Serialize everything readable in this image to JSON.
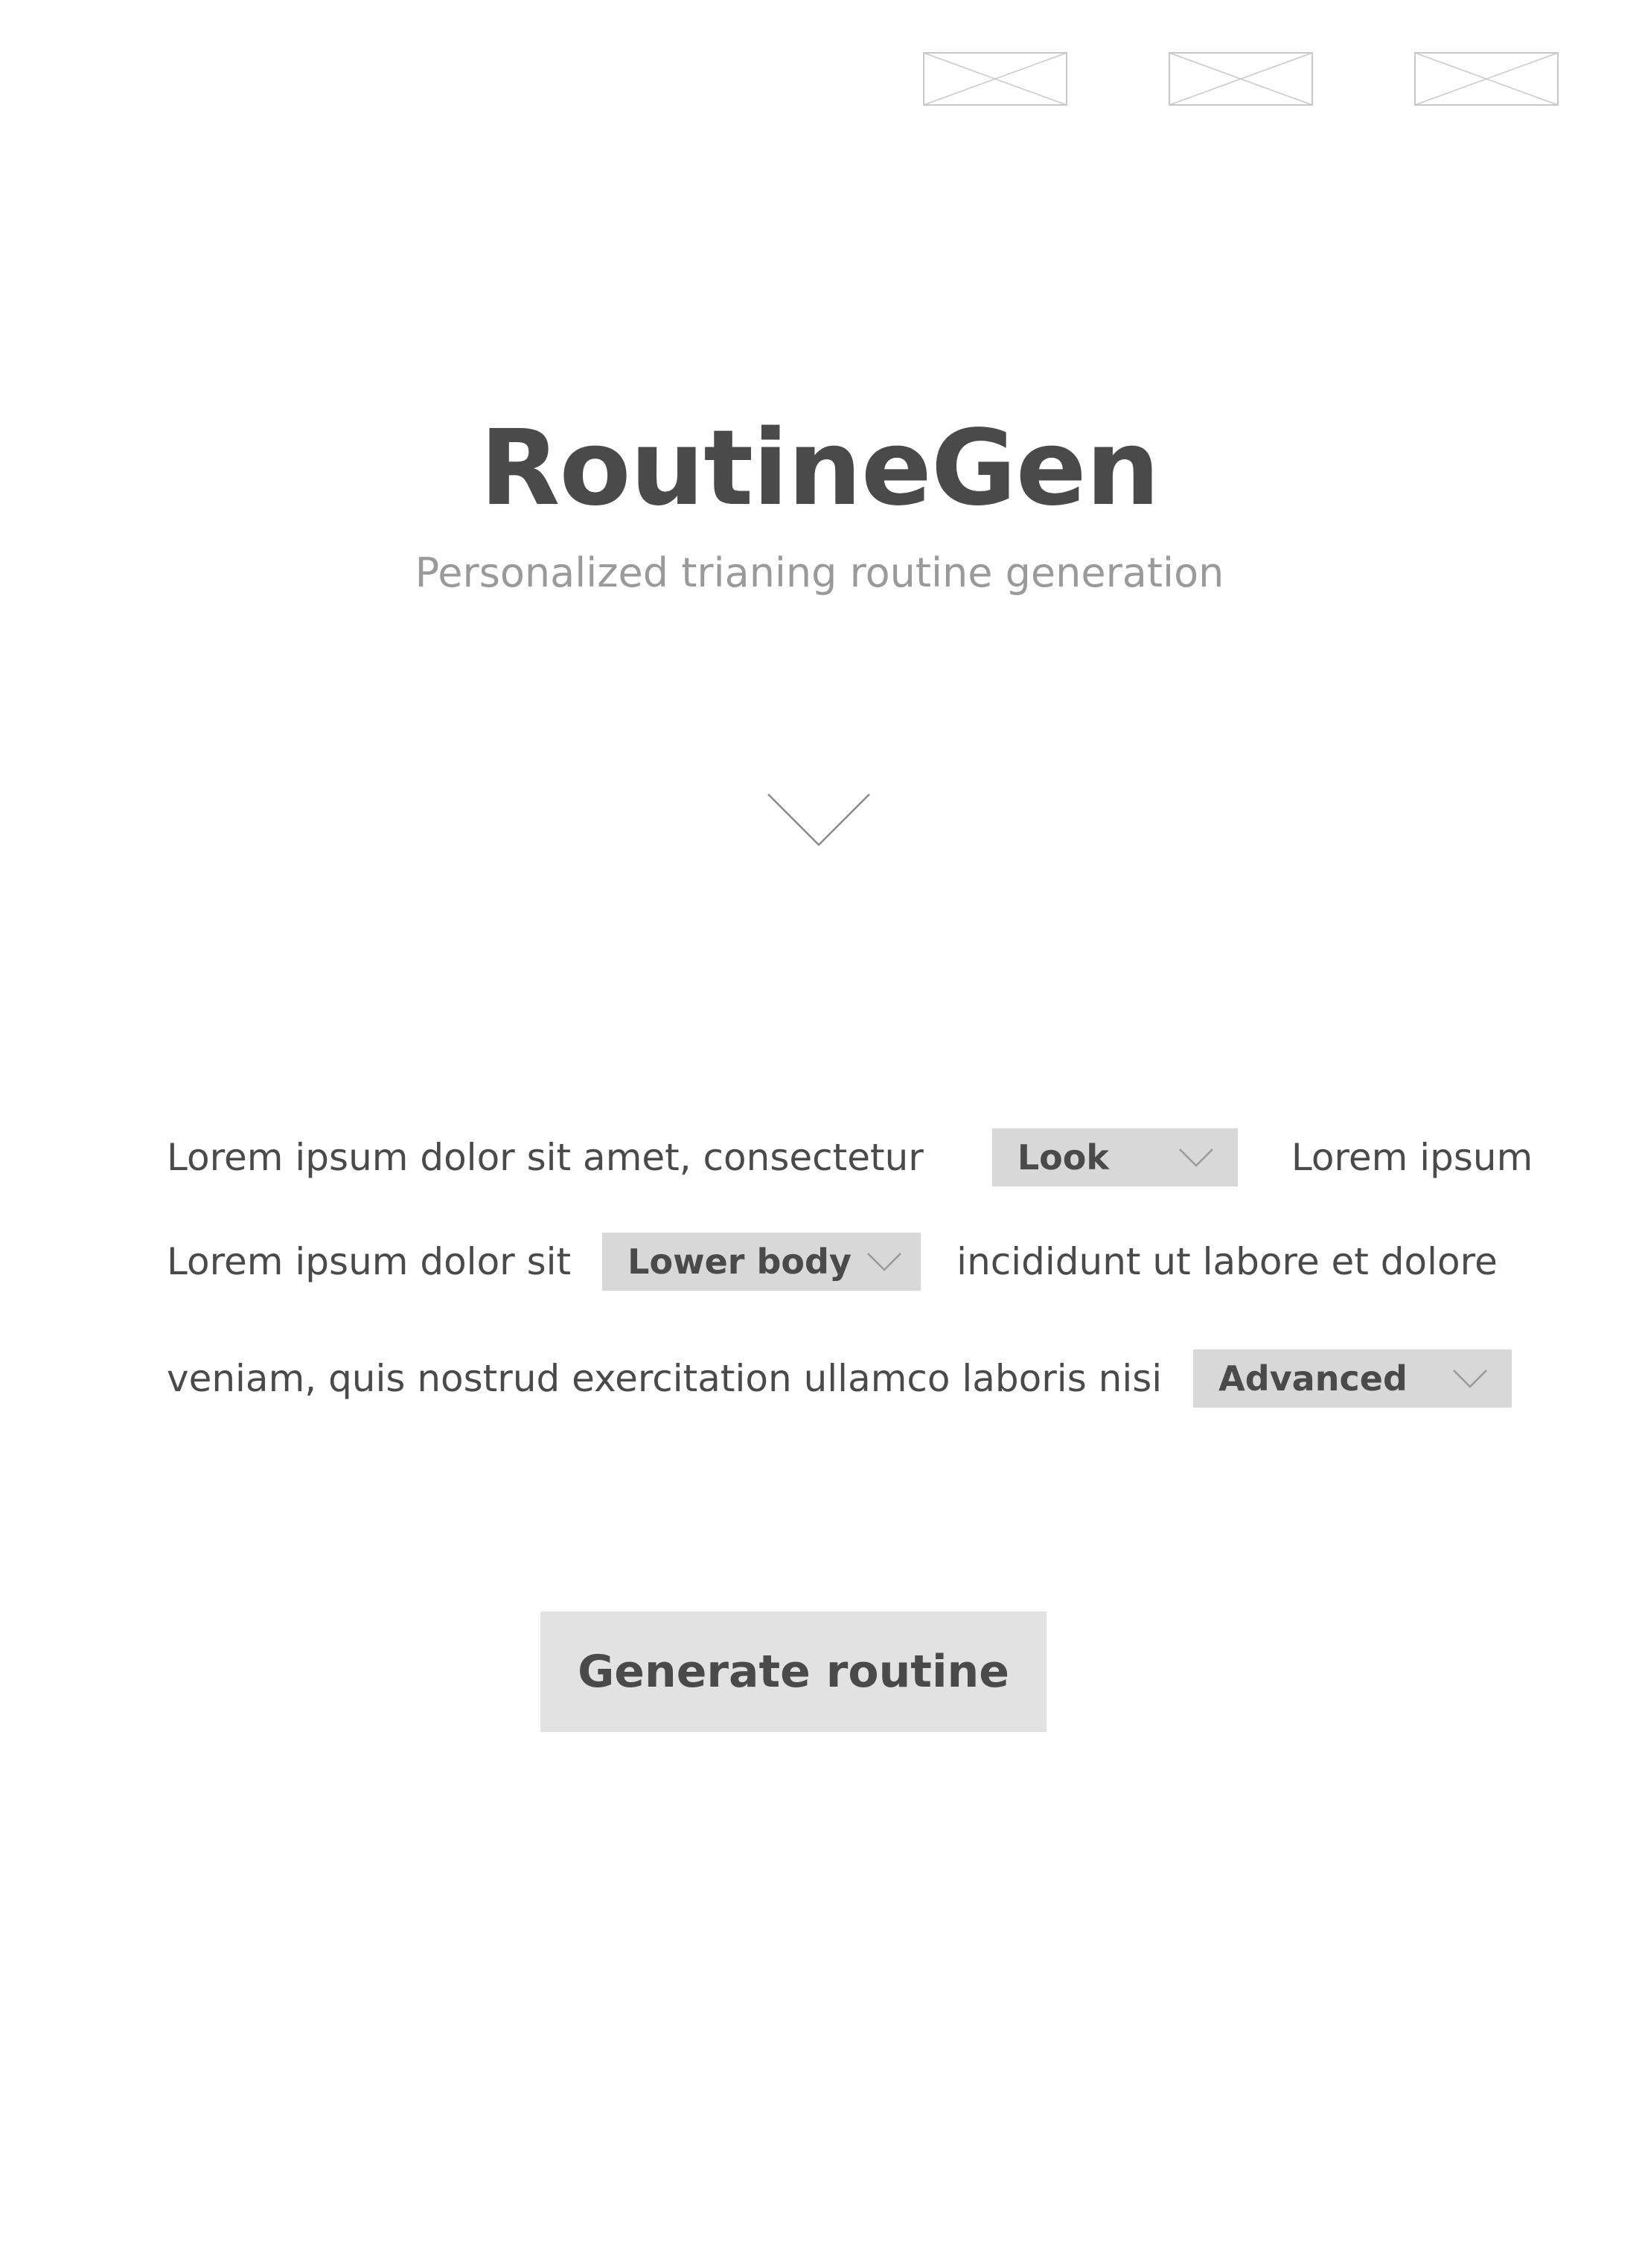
{
  "header": {
    "image_placeholders": [
      {
        "icon": "image-placeholder-icon"
      },
      {
        "icon": "image-placeholder-icon"
      },
      {
        "icon": "image-placeholder-icon"
      }
    ]
  },
  "hero": {
    "title": "RoutineGen",
    "subtitle": "Personalized trianing routine generation",
    "scroll_icon": "chevron-down-icon"
  },
  "form": {
    "line1": {
      "text_before": "Lorem ipsum dolor sit amet, consectetur",
      "select_value": "Look",
      "text_after": "Lorem ipsum"
    },
    "line2": {
      "text_before": "Lorem ipsum dolor sit",
      "select_value": "Lower body",
      "text_after": "incididunt ut labore et dolore"
    },
    "line3": {
      "text_before": "veniam, quis nostrud exercitation ullamco laboris nisi",
      "select_value": "Advanced"
    }
  },
  "actions": {
    "generate_label": "Generate routine"
  },
  "colors": {
    "text": "#4a4a4a",
    "subtitle": "#9a9a9a",
    "select_bg": "#d8d8d8",
    "button_bg": "#e2e2e2",
    "placeholder_stroke": "#c8c8c8"
  }
}
